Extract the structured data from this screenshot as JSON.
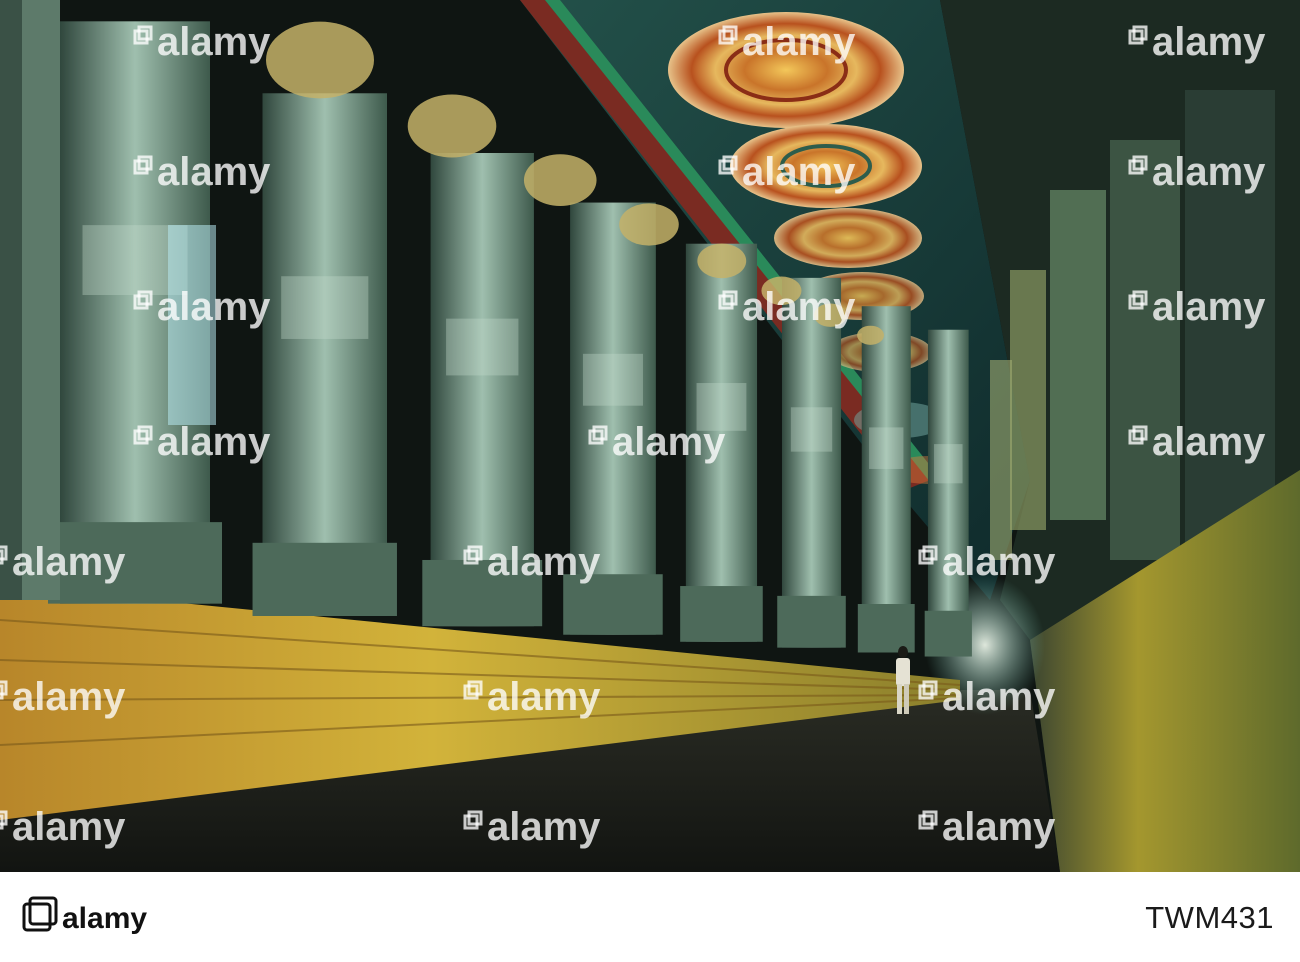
{
  "photo": {
    "subject": "corridor",
    "watermark": {
      "text": "alamy",
      "icon": "alamy-stack-icon"
    }
  },
  "footer": {
    "brand": "alamy",
    "image_id": "TWM431",
    "brand_icon": "alamy-stack-icon"
  },
  "colors": {
    "ceiling_orange": "#c9742a",
    "ceiling_teal": "#2c6e67",
    "pillar_lit": "#a9c6b2",
    "pillar_shadow": "#2e4a3f",
    "plinth_gold": "#c7a12c",
    "floor": "#1a1d19",
    "footer_bg": "#ffffff"
  }
}
